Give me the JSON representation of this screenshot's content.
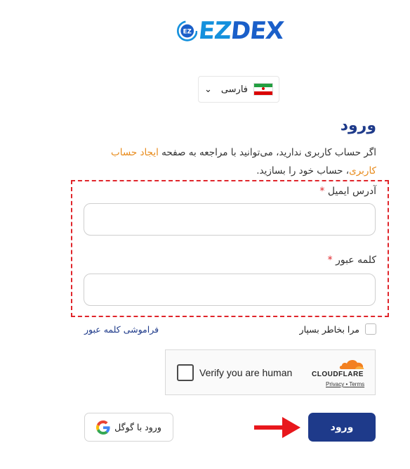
{
  "brand": {
    "logo_text_ez": "EZ",
    "logo_text_dex": "DEX",
    "logo_mark_text": "EZ"
  },
  "language": {
    "selected": "فارسی",
    "flag": "iran-flag-icon"
  },
  "page": {
    "title": "ورود",
    "intro_before": "اگر حساب کاربری ندارید، می‌توانید با مراجعه به صفحه ",
    "intro_link": "ایجاد حساب کاربری",
    "intro_after": "، حساب خود را بسازید."
  },
  "form": {
    "email_label": "آدرس ایمیل",
    "password_label": "کلمه عبور",
    "required_mark": "*",
    "email_value": "",
    "password_value": "",
    "remember_label": "مرا بخاطر بسپار",
    "forgot_label": "فراموشی کلمه عبور"
  },
  "captcha": {
    "label": "Verify you are human",
    "brand": "CLOUDFLARE",
    "privacy": "Privacy",
    "separator": " • ",
    "terms": "Terms"
  },
  "actions": {
    "login_label": "ورود",
    "google_label": "ورود با گوگل"
  },
  "colors": {
    "primary": "#1e3a8a",
    "accent_link": "#e88a1a",
    "required": "#e0252b",
    "annotation": "#e0252b"
  }
}
